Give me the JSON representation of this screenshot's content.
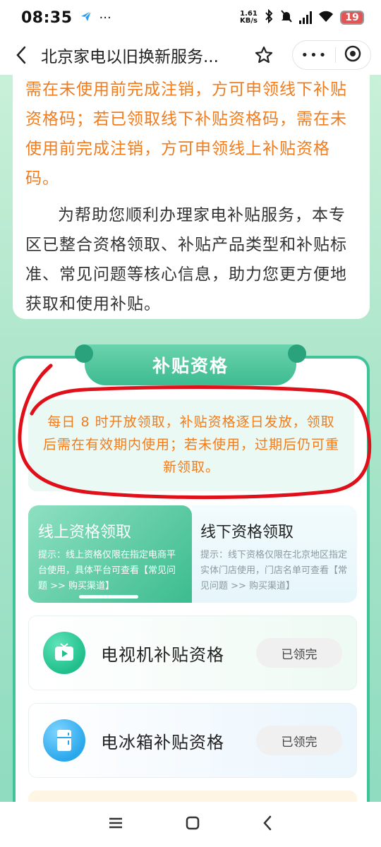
{
  "status_bar": {
    "time": "08:35",
    "more": "···",
    "net_speed_value": "1.61",
    "net_speed_unit": "KB/s",
    "battery": "19",
    "icons": [
      "send-icon",
      "bluetooth-icon",
      "mute-icon",
      "signal-icon",
      "wifi-icon",
      "battery-icon"
    ]
  },
  "nav": {
    "title": "北京家电以旧换新服务...",
    "more_label": "•••"
  },
  "intro": {
    "orange_text": "需在未使用前完成注销，方可申领线下补贴资格码；若已领取线下补贴资格码，需在未使用前完成注销，方可申领线上补贴资格码。",
    "dark_text": "为帮助您顺利办理家电补贴服务，本专区已整合资格领取、补贴产品类型和补贴标准、常见问题等核心信息，助力您更方便地获取和使用补贴。"
  },
  "subsidy": {
    "tab_label": "补贴资格",
    "notice": "每日 8 时开放领取，补贴资格逐日发放，领取后需在有效期内使用；若未使用，过期后仍可重新领取。",
    "online": {
      "title": "线上资格领取",
      "tip": "提示：线上资格仅限在指定电商平台使用，具体平台可查看【常见问题 >> 购买渠道】"
    },
    "offline": {
      "title": "线下资格领取",
      "tip": "提示：线下资格仅限在北京地区指定实体门店使用，门店名单可查看【常见问题 >> 购买渠道】"
    },
    "items": [
      {
        "name": "电视机补贴资格",
        "status": "已领完",
        "icon": "tv-icon"
      },
      {
        "name": "电冰箱补贴资格",
        "status": "已领完",
        "icon": "fridge-icon"
      }
    ]
  },
  "colors": {
    "accent_green": "#3fc49a",
    "orange_text": "#f07c1e",
    "annotation_red": "#e0101a"
  }
}
